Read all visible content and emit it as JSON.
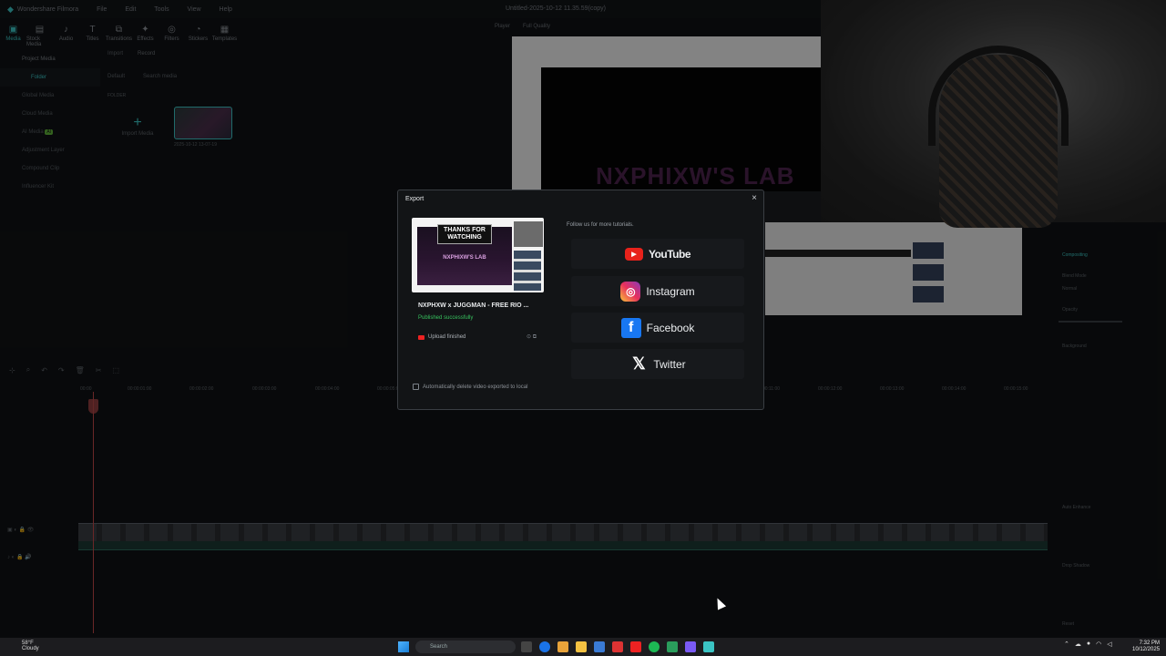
{
  "app": {
    "name": "Wondershare Filmora",
    "menu": [
      "File",
      "Edit",
      "Tools",
      "View",
      "Help"
    ],
    "window_title": "Untitled-2025-10-12 11.35.59(copy)"
  },
  "toolbar": {
    "items": [
      "Media",
      "Stock Media",
      "Audio",
      "Titles",
      "Transitions",
      "Effects",
      "Filters",
      "Stickers",
      "Templates"
    ]
  },
  "sidebar": {
    "items": [
      "Project Media",
      "Folder",
      "Global Media",
      "Cloud Media",
      "AI Media",
      "Adjustment Layer",
      "Compound Clip",
      "Influencer Kit"
    ],
    "ai_badge": "AI"
  },
  "media": {
    "import": "Import",
    "record": "Record",
    "sort": "Default",
    "search_placeholder": "Search media",
    "folder_label": "FOLDER",
    "import_tile": "Import Media",
    "clip_name": "2025-10-12 13-07-19"
  },
  "player": {
    "label": "Player",
    "quality": "Full Quality",
    "overlay_text": "NXPHIXW'S LAB"
  },
  "right_panel": {
    "compositing": "Compositing",
    "blend_mode": "Blend Mode",
    "blend_value": "Normal",
    "opacity": "Opacity",
    "opacity_value": "100.00",
    "background": "Background",
    "auto_enhance": "Auto Enhance",
    "drop_shadow": "Drop Shadow",
    "reset": "Reset"
  },
  "timeline": {
    "ticks": [
      "00:00",
      "00:00:01:00",
      "00:00:02:00",
      "00:00:03:00",
      "00:00:04:00",
      "00:00:05:00",
      "00:00:11:00",
      "00:00:12:00",
      "00:00:13:00",
      "00:00:14:00",
      "00:00:15:00"
    ]
  },
  "dialog": {
    "title": "Export",
    "close": "×",
    "preview": {
      "title_line": "THANKS FOR WATCHING",
      "subtitle": "NXPHIXW'S LAB"
    },
    "video_title": "NXPHXW x JUGGMAN - FREE RIO ...",
    "publish_status": "Published successfully",
    "upload_status": "Upload finished",
    "auto_delete_label": "Automatically delete video exported to local",
    "follow_text": "Follow us for more tutorials.",
    "socials": [
      {
        "name": "YouTube",
        "icon": "youtube-icon"
      },
      {
        "name": "Instagram",
        "icon": "instagram-icon"
      },
      {
        "name": "Facebook",
        "icon": "facebook-icon"
      },
      {
        "name": "Twitter",
        "icon": "x-twitter-icon"
      }
    ]
  },
  "taskbar": {
    "weather_temp": "58°F",
    "weather_desc": "Cloudy",
    "search_placeholder": "Search",
    "time": "7:32 PM",
    "date": "10/12/2025"
  },
  "colors": {
    "accent": "#3bc4c4",
    "success": "#37c25e",
    "youtube": "#e8221b",
    "facebook": "#1877f2"
  }
}
